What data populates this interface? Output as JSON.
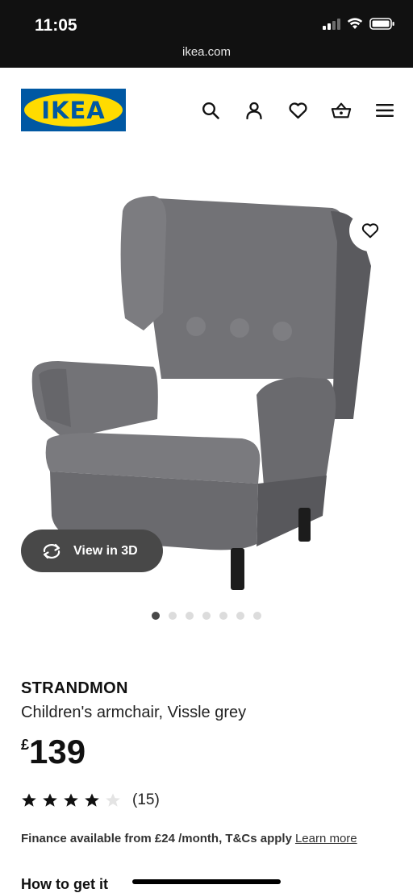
{
  "status_bar": {
    "time": "11:05",
    "url": "ikea.com"
  },
  "header": {
    "logo_text": "IKEA",
    "icons": [
      "search-icon",
      "account-icon",
      "heart-icon",
      "basket-icon",
      "menu-icon"
    ]
  },
  "gallery": {
    "view_3d_label": "View in 3D",
    "dots_total": 7,
    "active_dot": 1
  },
  "product": {
    "name": "STRANDMON",
    "description": "Children's armchair, Vissle grey",
    "price_currency": "£",
    "price_value": "139",
    "rating": 4,
    "rating_max": 5,
    "review_count": "(15)"
  },
  "finance": {
    "text": "Finance available from £24 /month, T&Cs apply",
    "link": "Learn more"
  },
  "sections": {
    "how_to_get_it": "How to get it"
  },
  "colors": {
    "brand_blue": "#0058a3",
    "brand_yellow": "#ffdb00",
    "chair_grey": "#6f6f73"
  }
}
